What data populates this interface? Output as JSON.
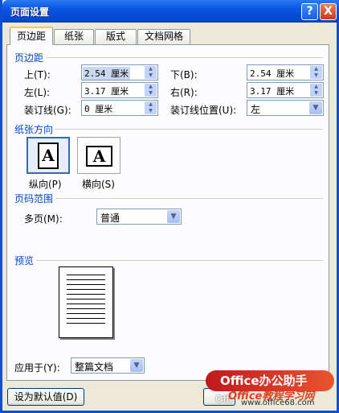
{
  "window": {
    "title": "页面设置"
  },
  "titlebar": {
    "help": "?",
    "close": "X"
  },
  "tabs": [
    {
      "label": "页边距",
      "active": true
    },
    {
      "label": "纸张",
      "active": false
    },
    {
      "label": "版式",
      "active": false
    },
    {
      "label": "文档网格",
      "active": false
    }
  ],
  "margins": {
    "section": "页边距",
    "top_label": "上(T):",
    "top_value": "2.54 厘米",
    "bottom_label": "下(B):",
    "bottom_value": "2.54 厘米",
    "left_label": "左(L):",
    "left_value": "3.17 厘米",
    "right_label": "右(R):",
    "right_value": "3.17 厘米",
    "gutter_label": "装订线(G):",
    "gutter_value": "0 厘米",
    "gutter_pos_label": "装订线位置(U):",
    "gutter_pos_value": "左"
  },
  "orientation": {
    "section": "纸张方向",
    "portrait_label": "纵向(P)",
    "landscape_label": "横向(S)",
    "icon_letter": "A",
    "selected": "portrait"
  },
  "pages": {
    "section": "页码范围",
    "multiple_label": "多页(M):",
    "multiple_value": "普通"
  },
  "preview": {
    "section": "预览",
    "apply_label": "应用于(Y):",
    "apply_value": "整篇文档"
  },
  "buttons": {
    "default": "设为默认值(D)"
  },
  "watermark": {
    "brand": "Office办公助手",
    "site": "Office教程学习网",
    "url": "www.office68.com",
    "partial": "Offi"
  },
  "icons": {
    "spin": "spin-arrows-icon",
    "dropdown": "chevron-down-icon"
  }
}
